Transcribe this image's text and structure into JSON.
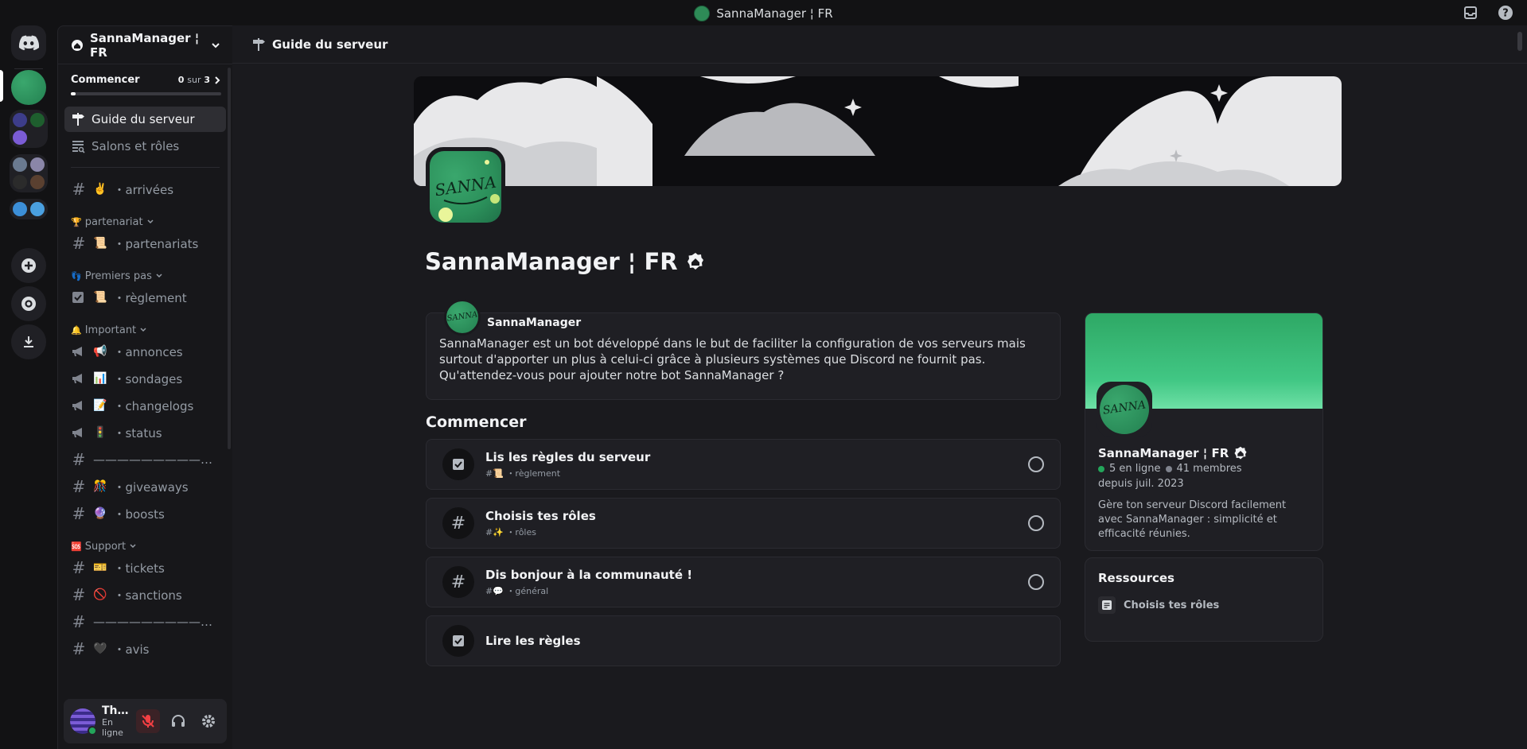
{
  "window": {
    "title": "SannaManager ¦ FR"
  },
  "rail": {
    "icons": [
      "discord-home-icon",
      "add-server-icon",
      "discover-icon",
      "download-icon"
    ]
  },
  "sidebar": {
    "server_name": "SannaManager ¦ FR",
    "onboarding": {
      "label": "Commencer",
      "done": "0",
      "of": "sur",
      "total": "3",
      "progress": 0
    },
    "nav": [
      {
        "label": "Guide du serveur"
      },
      {
        "label": "Salons et rôles"
      }
    ],
    "channels_top": [
      {
        "emoji": "✌️",
        "name": "・arrivées"
      }
    ],
    "categories": [
      {
        "emoji": "🏆",
        "name": "partenariat",
        "channels": [
          {
            "emoji": "📜",
            "name": "・partenariats",
            "icon": "hash"
          }
        ]
      },
      {
        "emoji": "👣",
        "name": "Premiers pas",
        "channels": [
          {
            "emoji": "📜",
            "name": "・règlement",
            "icon": "rules"
          }
        ]
      },
      {
        "emoji": "🔔",
        "name": "Important",
        "channels": [
          {
            "emoji": "📢",
            "name": "・annonces",
            "icon": "announce"
          },
          {
            "emoji": "📊",
            "name": "・sondages",
            "icon": "announce"
          },
          {
            "emoji": "📝",
            "name": "・changelogs",
            "icon": "announce"
          },
          {
            "emoji": "🚦",
            "name": "・status",
            "icon": "announce"
          },
          {
            "emoji": "",
            "name": "————————————————",
            "icon": "hash"
          },
          {
            "emoji": "🎊",
            "name": "・giveaways",
            "icon": "hash"
          },
          {
            "emoji": "🔮",
            "name": "・boosts",
            "icon": "hash"
          }
        ]
      },
      {
        "emoji": "🆘",
        "name": "Support",
        "channels": [
          {
            "emoji": "🎫",
            "name": "・tickets",
            "icon": "hash"
          },
          {
            "emoji": "🚫",
            "name": "・sanctions",
            "icon": "hash"
          },
          {
            "emoji": "",
            "name": "————————————————",
            "icon": "hash"
          },
          {
            "emoji": "🖤",
            "name": "・avis",
            "icon": "hash"
          }
        ]
      }
    ]
  },
  "user": {
    "name": "Thibaut Hoz...",
    "status": "En ligne"
  },
  "main": {
    "header_title": "Guide du serveur",
    "server_title": "SannaManager ¦ FR",
    "welcome": {
      "bot_name": "SannaManager",
      "message": "SannaManager est un bot développé dans le but de faciliter la configuration de vos serveurs mais surtout d'apporter un plus à celui-ci grâce à plusieurs systèmes que Discord ne fournit pas. Qu'attendez-vous pour ajouter notre bot SannaManager ?"
    },
    "section_title": "Commencer",
    "tasks": [
      {
        "title": "Lis les règles du serveur",
        "sub": "#📜 ・règlement",
        "icon": "rules-icon"
      },
      {
        "title": "Choisis tes rôles",
        "sub": "#✨ ・rôles",
        "icon": "hash-icon"
      },
      {
        "title": "Dis bonjour à la communauté !",
        "sub": "#💬 ・général",
        "icon": "hash-icon"
      },
      {
        "title": "Lire les règles",
        "sub": "",
        "icon": "rules-icon"
      }
    ],
    "server_card": {
      "name": "SannaManager ¦ FR",
      "online": "5 en ligne",
      "members": "41 membres",
      "since": "depuis juil. 2023",
      "description": "Gère ton serveur Discord facilement avec SannaManager : simplicité et efficacité réunies."
    },
    "resources": {
      "title": "Ressources",
      "items": [
        {
          "label": "Choisis tes rôles"
        }
      ]
    }
  },
  "colors": {
    "accent_green": "#23a55a",
    "banner_green": "#41c784",
    "bg": "#1a1a1e",
    "muted_red": "#f23f43"
  }
}
